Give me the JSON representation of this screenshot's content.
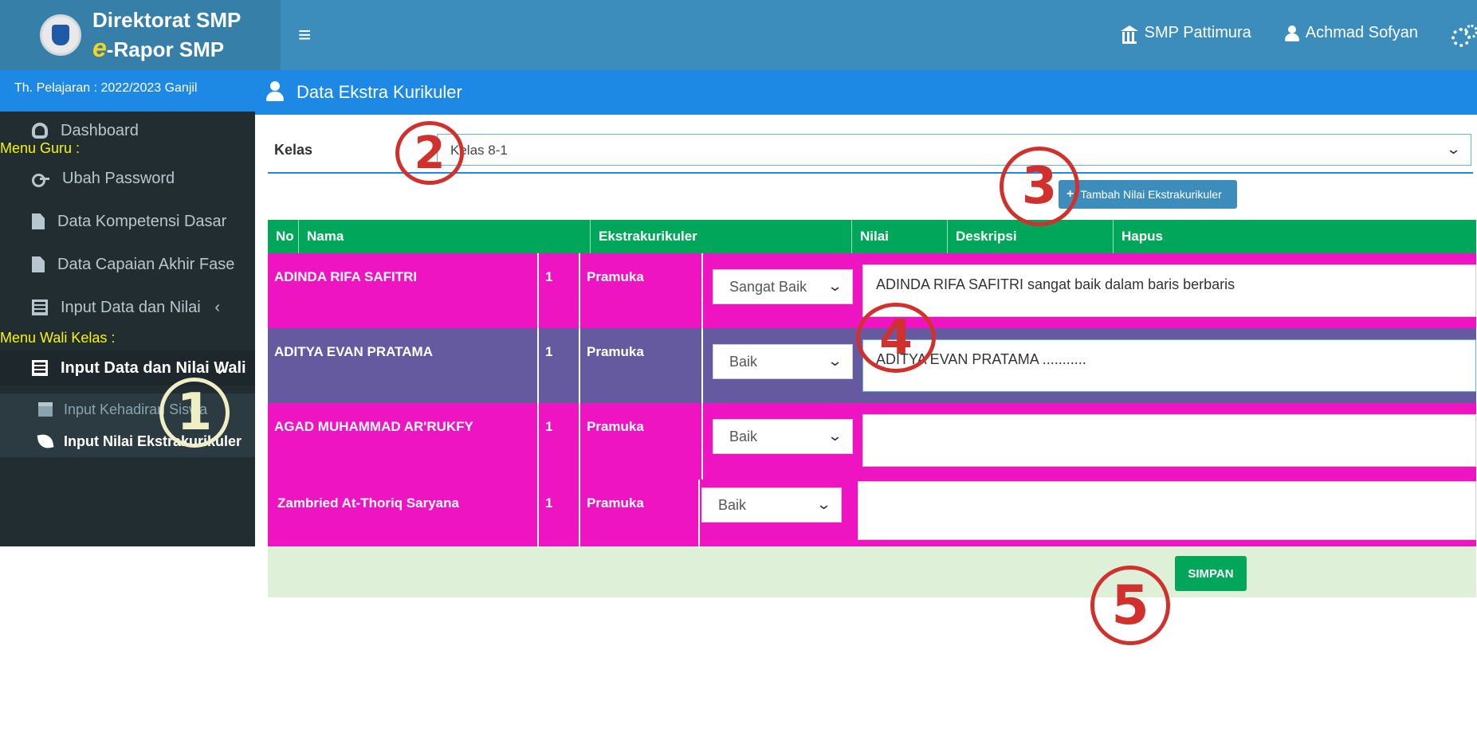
{
  "header": {
    "logo_line1": "Direktorat SMP",
    "logo_line2_prefix": "e",
    "logo_line2_rest": "-Rapor SMP",
    "school": "SMP Pattimura",
    "user": "Achmad Sofyan"
  },
  "sidebar": {
    "year": "Th. Pelajaran : 2022/2023 Ganjil",
    "dashboard": "Dashboard",
    "menu_guru": "Menu Guru :",
    "ubah_password": "Ubah Password",
    "data_kd": "Data Kompetensi Dasar",
    "data_capaian": "Data Capaian Akhir Fase",
    "input_data_nilai": "Input Data dan Nilai",
    "menu_wali": "Menu Wali Kelas :",
    "input_data_nilai_wali": "Input Data dan Nilai Wali",
    "input_kehadiran": "Input Kehadiran Siswa",
    "input_nilai_ekstra": "Input Nilai Ekstrakurikuler"
  },
  "page": {
    "title": "Data Ekstra Kurikuler",
    "kelas_label": "Kelas",
    "kelas_value": "Kelas 8-1",
    "tambah_button": "Tambah Nilai Ekstrakurikuler",
    "simpan_button": "SIMPAN"
  },
  "table": {
    "headers": {
      "no": "No",
      "nama": "Nama",
      "ekstra": "Ekstrakurikuler",
      "nilai": "Nilai",
      "deskripsi": "Deskripsi",
      "hapus": "Hapus"
    },
    "rows": [
      {
        "nama": "ADINDA RIFA SAFITRI",
        "no": "1",
        "ekstra": "Pramuka",
        "nilai": "Sangat Baik",
        "deskripsi": "ADINDA RIFA SAFITRI sangat baik dalam baris berbaris"
      },
      {
        "nama": "ADITYA EVAN PRATAMA",
        "no": "1",
        "ekstra": "Pramuka",
        "nilai": "Baik",
        "deskripsi": "ADITYA EVAN PRATAMA ..........."
      },
      {
        "nama": "AGAD MUHAMMAD AR'RUKFY",
        "no": "1",
        "ekstra": "Pramuka",
        "nilai": "Baik",
        "deskripsi": ""
      },
      {
        "nama": "Zambried At-Thoriq Saryana",
        "no": "1",
        "ekstra": "Pramuka",
        "nilai": "Baik",
        "deskripsi": ""
      }
    ]
  },
  "callouts": [
    "1",
    "2",
    "3",
    "4",
    "5"
  ],
  "colors": {
    "header_blue": "#3c8dbc",
    "primary_blue": "#1e88e5",
    "table_header_green": "#00a65a",
    "row_magenta": "#ef14c2",
    "row_purple": "#655a9f",
    "callout_red": "#d0312d",
    "callout_cream": "#efefc6"
  }
}
